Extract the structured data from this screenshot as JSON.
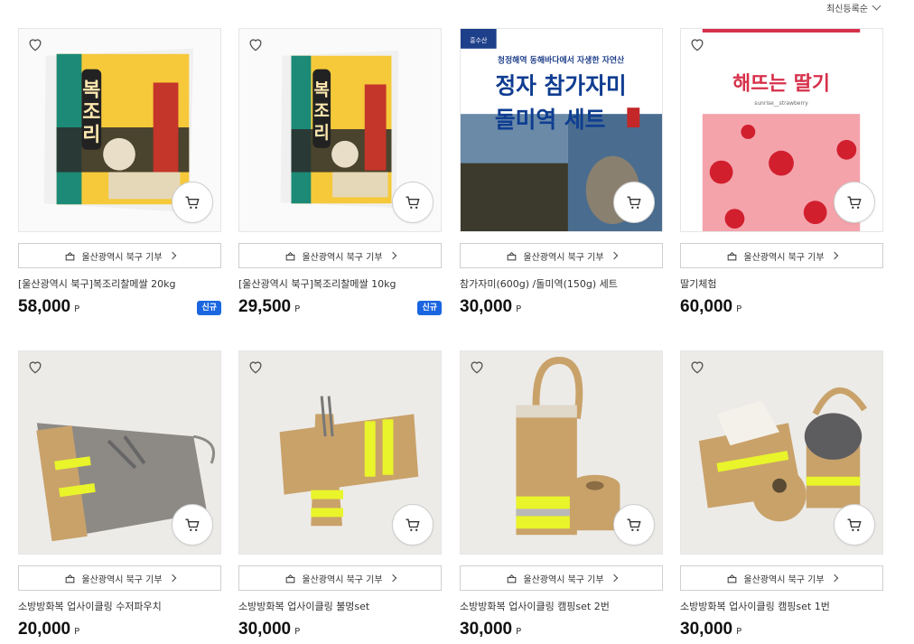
{
  "sort": {
    "label": "최신등록순"
  },
  "products": [
    {
      "donate_label": "울산광역시 북구 기부",
      "name": "[울산광역시 북구]복조리찰메쌀 20kg",
      "price": "58,000",
      "unit": "P",
      "badge": "신규",
      "image": {
        "rice_brand": "복조리",
        "bag_main": "#f3c21f",
        "bag_side": "#197d6b"
      }
    },
    {
      "donate_label": "울산광역시 북구 기부",
      "name": "[울산광역시 북구]복조리찰메쌀 10kg",
      "price": "29,500",
      "unit": "P",
      "badge": "신규",
      "image": {
        "rice_brand": "복조리",
        "bag_main": "#f3c21f",
        "bag_side": "#197d6b"
      }
    },
    {
      "donate_label": "울산광역시 북구 기부",
      "name": "참가자미(600g) /돌미역(150g) 세트",
      "price": "30,000",
      "unit": "P",
      "badge": "",
      "image": {
        "logo_text": "흥수산",
        "subtitle": "청정해역 동해바다에서 자생한 자연산",
        "title_line1": "정자 참가자미",
        "title_line2": "돌미역 세트"
      }
    },
    {
      "donate_label": "울산광역시 북구 기부",
      "name": "딸기체험",
      "price": "60,000",
      "unit": "P",
      "badge": "",
      "image": {
        "top_text": "해뜨는 딸기",
        "caption": "sunrise__strawberry"
      }
    },
    {
      "donate_label": "울산광역시 북구 기부",
      "name": "소방방화복 업사이클링 수저파우치",
      "price": "20,000",
      "unit": "P",
      "badge": "",
      "image": {}
    },
    {
      "donate_label": "울산광역시 북구 기부",
      "name": "소방방화복 업사이클링 불멍set",
      "price": "30,000",
      "unit": "P",
      "badge": "",
      "image": {}
    },
    {
      "donate_label": "울산광역시 북구 기부",
      "name": "소방방화복 업사이클링 캠핑set 2번",
      "price": "30,000",
      "unit": "P",
      "badge": "",
      "image": {}
    },
    {
      "donate_label": "울산광역시 북구 기부",
      "name": "소방방화복 업사이클링 캠핑set 1번",
      "price": "30,000",
      "unit": "P",
      "badge": "",
      "image": {}
    }
  ],
  "colors": {
    "badge": "#1a66e0",
    "accent_yellow": "#e9f42a",
    "kraft": "#c9a26a"
  }
}
